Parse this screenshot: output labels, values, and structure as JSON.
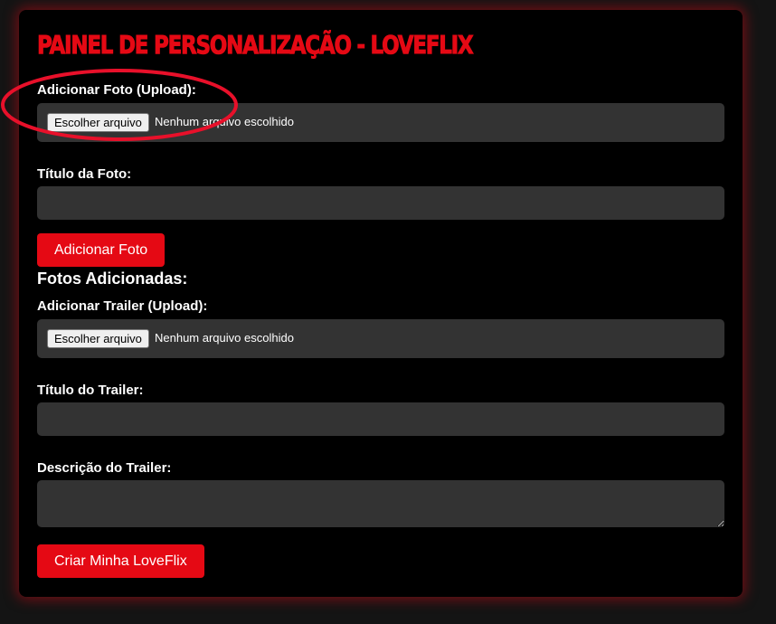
{
  "panel": {
    "title": "PAINEL DE PERSONALIZAÇÃO - LOVEFLIX"
  },
  "photo": {
    "upload_label": "Adicionar Foto (Upload):",
    "file_button": "Escolher arquivo",
    "file_status": "Nenhum arquivo escolhido",
    "title_label": "Título da Foto:",
    "title_value": "",
    "add_button": "Adicionar Foto",
    "list_heading": "Fotos Adicionadas:"
  },
  "trailer": {
    "upload_label": "Adicionar Trailer (Upload):",
    "file_button": "Escolher arquivo",
    "file_status": "Nenhum arquivo escolhido",
    "title_label": "Título do Trailer:",
    "title_value": "",
    "description_label": "Descrição do Trailer:",
    "description_value": ""
  },
  "actions": {
    "create_button": "Criar Minha LoveFlix"
  },
  "colors": {
    "accent": "#e50914",
    "panel_bg": "#000000",
    "page_bg": "#141414",
    "field_bg": "#333333",
    "annotation": "#e8102a"
  }
}
